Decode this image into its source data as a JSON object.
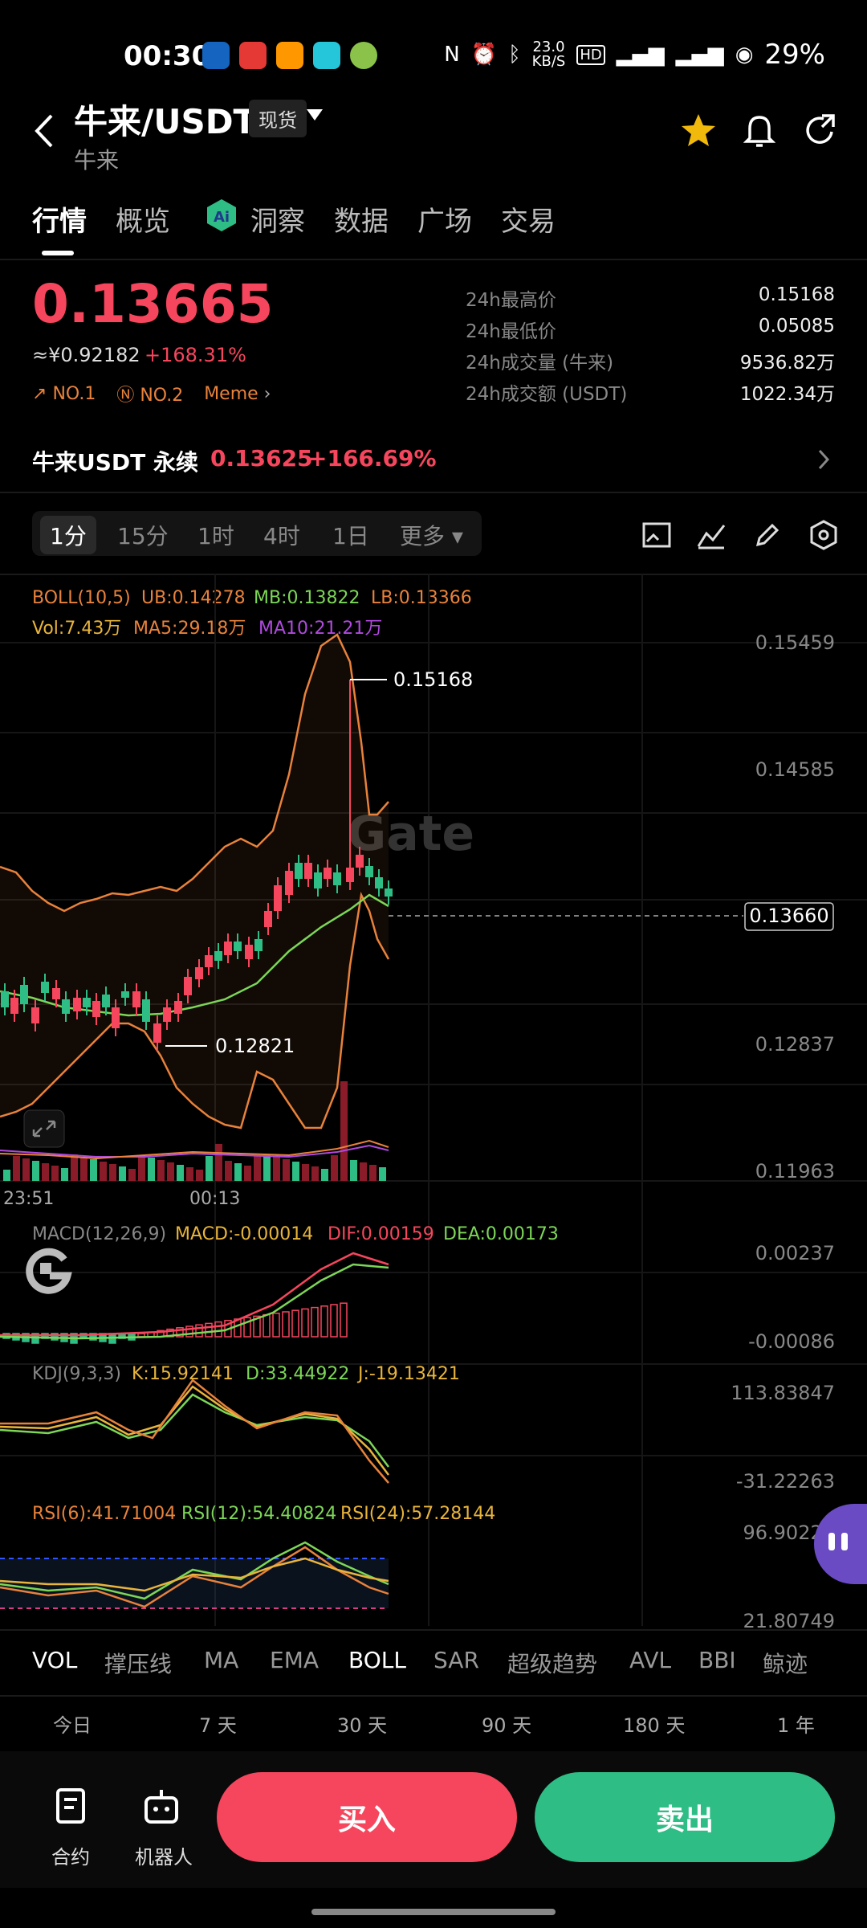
{
  "status": {
    "time": "00:30",
    "speed": "23.0",
    "speed_unit": "KB/S",
    "battery": "29%"
  },
  "header": {
    "pair": "牛来/USDT",
    "market_tag": "现货",
    "subtitle": "牛来"
  },
  "tabs": [
    "行情",
    "概览",
    "洞察",
    "数据",
    "广场",
    "交易"
  ],
  "price": {
    "last": "0.13665",
    "cny": "≈¥0.92182",
    "change": "+168.31%",
    "badges": [
      "NO.1",
      "NO.2",
      "Meme"
    ]
  },
  "stats": [
    {
      "label": "24h最高价",
      "value": "0.15168"
    },
    {
      "label": "24h最低价",
      "value": "0.05085"
    },
    {
      "label": "24h成交量 (牛来)",
      "value": "9536.82万"
    },
    {
      "label": "24h成交额 (USDT)",
      "value": "1022.34万"
    }
  ],
  "perp": {
    "label": "牛来USDT 永续",
    "price": "0.13625",
    "change": "+166.69%"
  },
  "timeframes": [
    "1分",
    "15分",
    "1时",
    "4时",
    "1日",
    "更多"
  ],
  "indicators": {
    "boll": "BOLL(10,5)",
    "ub": "UB:0.14278",
    "mb": "MB:0.13822",
    "lb": "LB:0.13366",
    "vol": "Vol:7.43万",
    "ma5": "MA5:29.18万",
    "ma10": "MA10:21.21万",
    "macd_name": "MACD(12,26,9)",
    "macd": "MACD:-0.00014",
    "dif": "DIF:0.00159",
    "dea": "DEA:0.00173",
    "kdj_name": "KDJ(9,3,3)",
    "k": "K:15.92141",
    "d": "D:33.44922",
    "j": "J:-19.13421",
    "rsi6": "RSI(6):41.71004",
    "rsi12": "RSI(12):54.40824",
    "rsi24": "RSI(24):57.28144"
  },
  "axis": {
    "main": [
      "0.15459",
      "0.14585",
      "0.12837",
      "0.11963"
    ],
    "macd": [
      "0.00237",
      "-0.00086"
    ],
    "kdj": [
      "113.83847",
      "-31.22263"
    ],
    "rsi": [
      "96.90222",
      "21.80749"
    ],
    "time": [
      "23:51",
      "00:13"
    ]
  },
  "markers": {
    "high": "0.15168",
    "low": "0.12821",
    "current": "0.13660"
  },
  "watermark": "Gate",
  "bottom_tabs": [
    "VOL",
    "撑压线",
    "MA",
    "EMA",
    "BOLL",
    "SAR",
    "超级趋势",
    "AVL",
    "BBI",
    "鲸迹"
  ],
  "ranges": [
    "今日",
    "7 天",
    "30 天",
    "90 天",
    "180 天",
    "1 年"
  ],
  "footer": {
    "contract": "合约",
    "bot": "机器人",
    "buy": "买入",
    "sell": "卖出"
  },
  "colors": {
    "up": "#f6465d",
    "down": "#2ebd85",
    "accent": "#e8823b"
  }
}
